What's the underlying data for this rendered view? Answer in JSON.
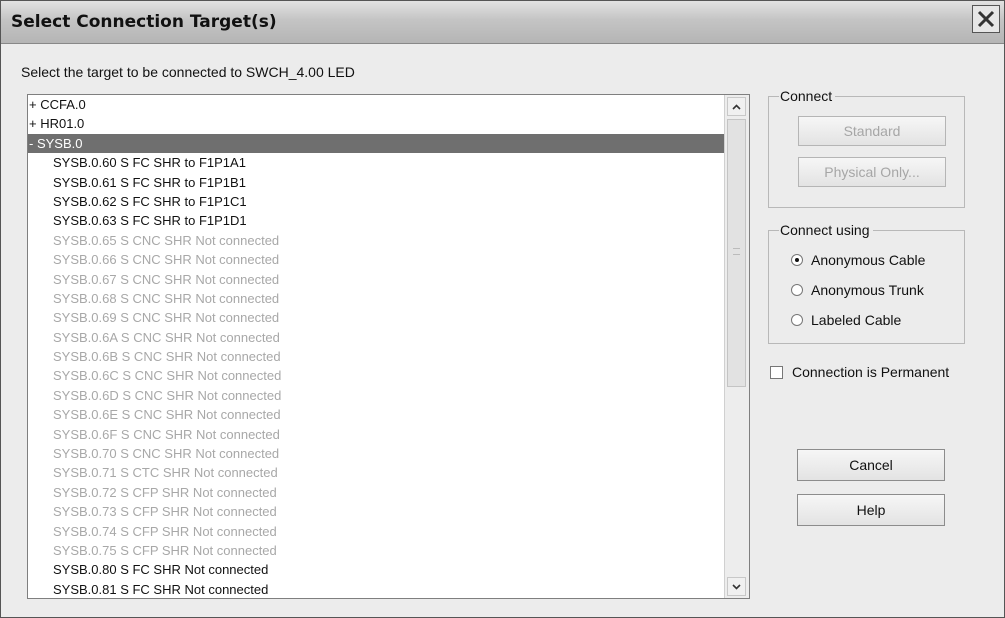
{
  "window": {
    "title": "Select Connection Target(s)"
  },
  "prompt": "Select the target to be connected to SWCH_4.00 LED",
  "list": {
    "items": [
      {
        "label": "+ CCFA.0",
        "kind": "group"
      },
      {
        "label": "+ HR01.0",
        "kind": "group"
      },
      {
        "label": "- SYSB.0",
        "kind": "group",
        "selected": true
      },
      {
        "label": "SYSB.0.60 S FC SHR to F1P1A1",
        "kind": "child"
      },
      {
        "label": "SYSB.0.61 S FC SHR to F1P1B1",
        "kind": "child"
      },
      {
        "label": "SYSB.0.62 S FC SHR to F1P1C1",
        "kind": "child"
      },
      {
        "label": "SYSB.0.63 S FC SHR to F1P1D1",
        "kind": "child"
      },
      {
        "label": "SYSB.0.65 S CNC SHR Not connected",
        "kind": "child",
        "disabled": true
      },
      {
        "label": "SYSB.0.66 S CNC SHR Not connected",
        "kind": "child",
        "disabled": true
      },
      {
        "label": "SYSB.0.67 S CNC SHR Not connected",
        "kind": "child",
        "disabled": true
      },
      {
        "label": "SYSB.0.68 S CNC SHR Not connected",
        "kind": "child",
        "disabled": true
      },
      {
        "label": "SYSB.0.69 S CNC SHR Not connected",
        "kind": "child",
        "disabled": true
      },
      {
        "label": "SYSB.0.6A S CNC SHR Not connected",
        "kind": "child",
        "disabled": true
      },
      {
        "label": "SYSB.0.6B S CNC SHR Not connected",
        "kind": "child",
        "disabled": true
      },
      {
        "label": "SYSB.0.6C S CNC SHR Not connected",
        "kind": "child",
        "disabled": true
      },
      {
        "label": "SYSB.0.6D S CNC SHR Not connected",
        "kind": "child",
        "disabled": true
      },
      {
        "label": "SYSB.0.6E S CNC SHR Not connected",
        "kind": "child",
        "disabled": true
      },
      {
        "label": "SYSB.0.6F S CNC SHR Not connected",
        "kind": "child",
        "disabled": true
      },
      {
        "label": "SYSB.0.70 S CNC SHR Not connected",
        "kind": "child",
        "disabled": true
      },
      {
        "label": "SYSB.0.71 S CTC SHR Not connected",
        "kind": "child",
        "disabled": true
      },
      {
        "label": "SYSB.0.72 S CFP SHR Not connected",
        "kind": "child",
        "disabled": true
      },
      {
        "label": "SYSB.0.73 S CFP SHR Not connected",
        "kind": "child",
        "disabled": true
      },
      {
        "label": "SYSB.0.74 S CFP SHR Not connected",
        "kind": "child",
        "disabled": true
      },
      {
        "label": "SYSB.0.75 S CFP SHR Not connected",
        "kind": "child",
        "disabled": true
      },
      {
        "label": "SYSB.0.80 S FC SHR Not connected",
        "kind": "child"
      },
      {
        "label": "SYSB.0.81 S FC SHR Not connected",
        "kind": "child"
      }
    ]
  },
  "connect": {
    "legend": "Connect",
    "standard_label": "Standard",
    "physical_label": "Physical Only..."
  },
  "connect_using": {
    "legend": "Connect using",
    "options": [
      "Anonymous Cable",
      "Anonymous Trunk",
      "Labeled Cable"
    ],
    "selected": "Anonymous Cable"
  },
  "permanent": {
    "label": "Connection is Permanent",
    "checked": false
  },
  "buttons": {
    "cancel": "Cancel",
    "help": "Help"
  },
  "icons": {
    "close": "close-icon",
    "scroll_up": "chevron-up-icon",
    "scroll_down": "chevron-down-icon"
  }
}
